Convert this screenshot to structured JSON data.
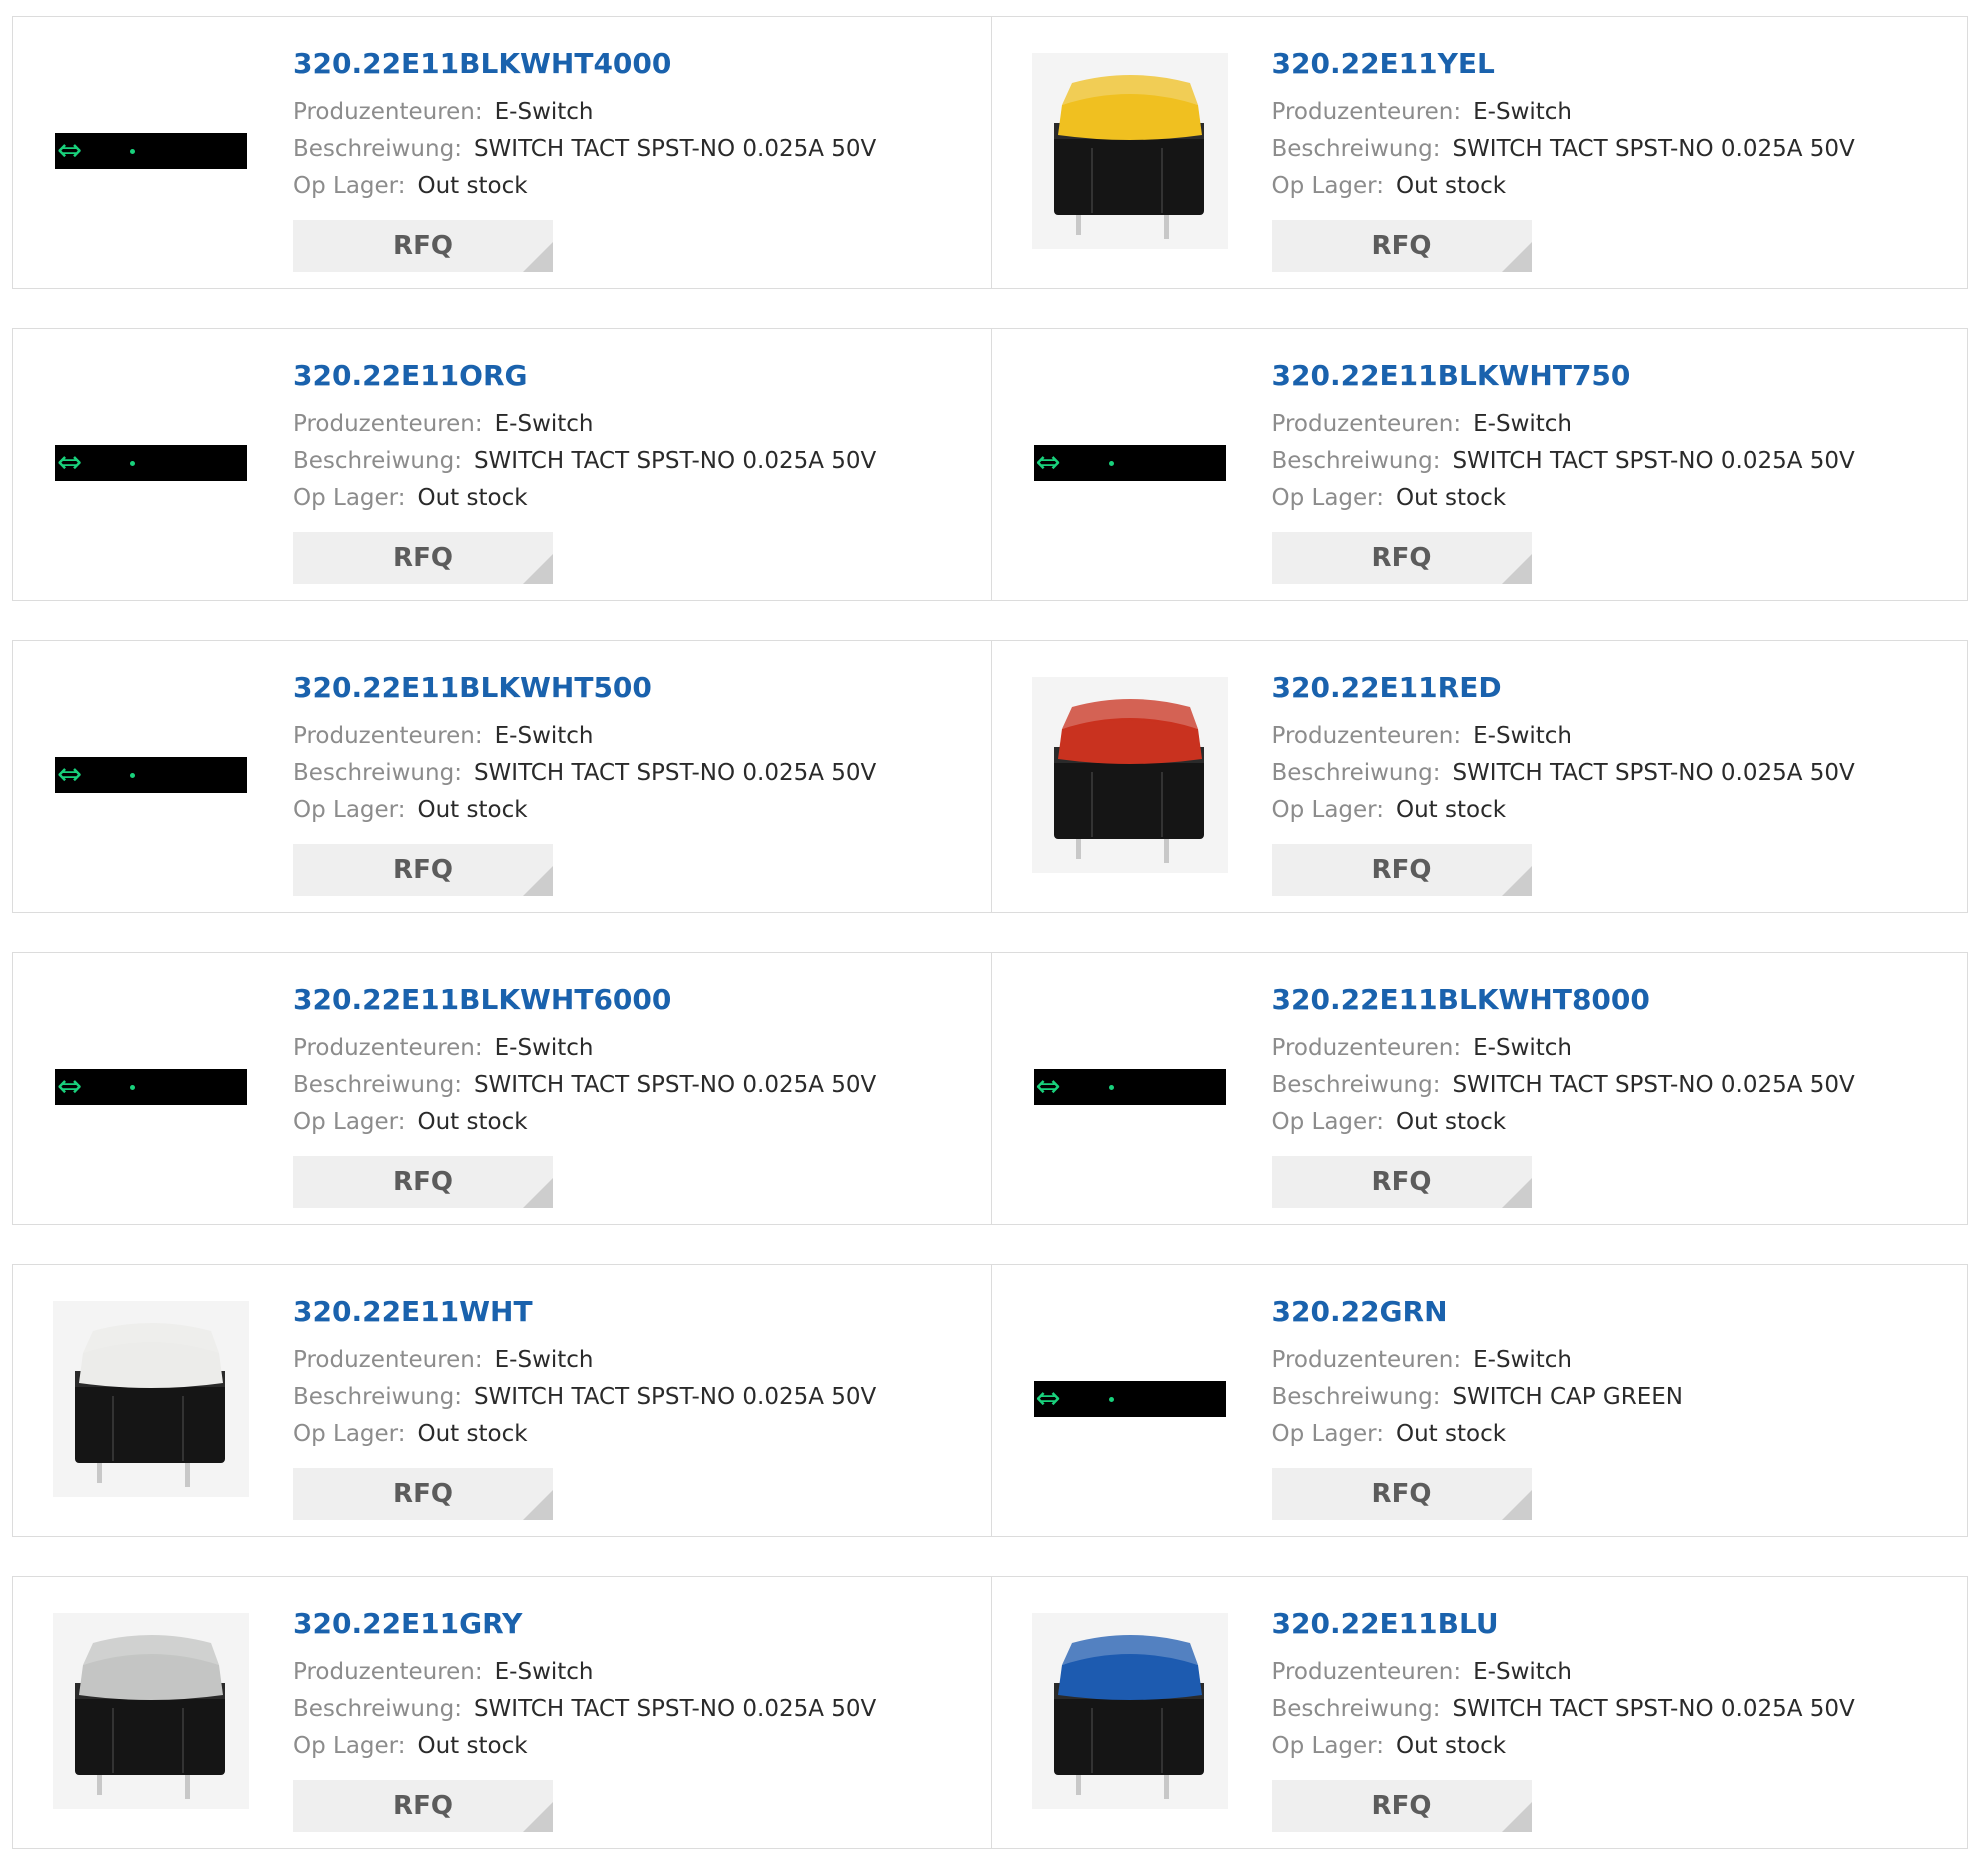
{
  "labels": {
    "manufacturer": "Produzenteuren:",
    "description": "Beschreiwung:",
    "stock": "Op Lager:",
    "rfq": "RFQ"
  },
  "rows": [
    [
      {
        "part": "320.22E11BLKWHT4000",
        "manufacturer": "E-Switch",
        "description": "SWITCH TACT SPST-NO 0.025A 50V",
        "stock": "Out stock",
        "image": "placeholder"
      },
      {
        "part": "320.22E11YEL",
        "manufacturer": "E-Switch",
        "description": "SWITCH TACT SPST-NO 0.025A 50V",
        "stock": "Out stock",
        "image": "switch",
        "cap_color": "#f0c020"
      }
    ],
    [
      {
        "part": "320.22E11ORG",
        "manufacturer": "E-Switch",
        "description": "SWITCH TACT SPST-NO 0.025A 50V",
        "stock": "Out stock",
        "image": "placeholder"
      },
      {
        "part": "320.22E11BLKWHT750",
        "manufacturer": "E-Switch",
        "description": "SWITCH TACT SPST-NO 0.025A 50V",
        "stock": "Out stock",
        "image": "placeholder"
      }
    ],
    [
      {
        "part": "320.22E11BLKWHT500",
        "manufacturer": "E-Switch",
        "description": "SWITCH TACT SPST-NO 0.025A 50V",
        "stock": "Out stock",
        "image": "placeholder"
      },
      {
        "part": "320.22E11RED",
        "manufacturer": "E-Switch",
        "description": "SWITCH TACT SPST-NO 0.025A 50V",
        "stock": "Out stock",
        "image": "switch",
        "cap_color": "#c9321f"
      }
    ],
    [
      {
        "part": "320.22E11BLKWHT6000",
        "manufacturer": "E-Switch",
        "description": "SWITCH TACT SPST-NO 0.025A 50V",
        "stock": "Out stock",
        "image": "placeholder"
      },
      {
        "part": "320.22E11BLKWHT8000",
        "manufacturer": "E-Switch",
        "description": "SWITCH TACT SPST-NO 0.025A 50V",
        "stock": "Out stock",
        "image": "placeholder"
      }
    ],
    [
      {
        "part": "320.22E11WHT",
        "manufacturer": "E-Switch",
        "description": "SWITCH TACT SPST-NO 0.025A 50V",
        "stock": "Out stock",
        "image": "switch",
        "cap_color": "#ececea"
      },
      {
        "part": "320.22GRN",
        "manufacturer": "E-Switch",
        "description": "SWITCH CAP GREEN",
        "stock": "Out stock",
        "image": "placeholder"
      }
    ],
    [
      {
        "part": "320.22E11GRY",
        "manufacturer": "E-Switch",
        "description": "SWITCH TACT SPST-NO 0.025A 50V",
        "stock": "Out stock",
        "image": "switch",
        "cap_color": "#c4c5c4"
      },
      {
        "part": "320.22E11BLU",
        "manufacturer": "E-Switch",
        "description": "SWITCH TACT SPST-NO 0.025A 50V",
        "stock": "Out stock",
        "image": "switch",
        "cap_color": "#1d5bb0"
      }
    ]
  ]
}
